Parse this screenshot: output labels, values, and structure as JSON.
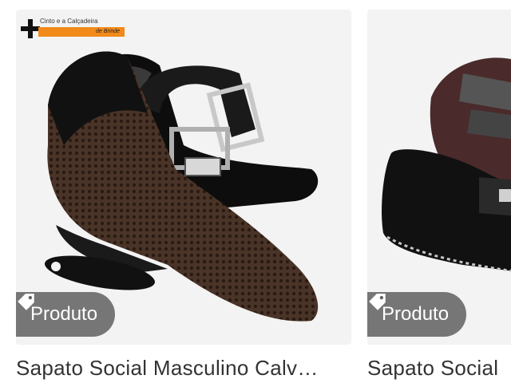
{
  "products": [
    {
      "promo_line1": "Cinto e a Calçadeira",
      "promo_line2": "de Brinde",
      "badge_label": "Produto",
      "badge_icon": "tag-icon",
      "title": "Sapato Social Masculino Calv…"
    },
    {
      "badge_label": "Produto",
      "badge_icon": "tag-icon",
      "title": "Sapato Social"
    }
  ]
}
